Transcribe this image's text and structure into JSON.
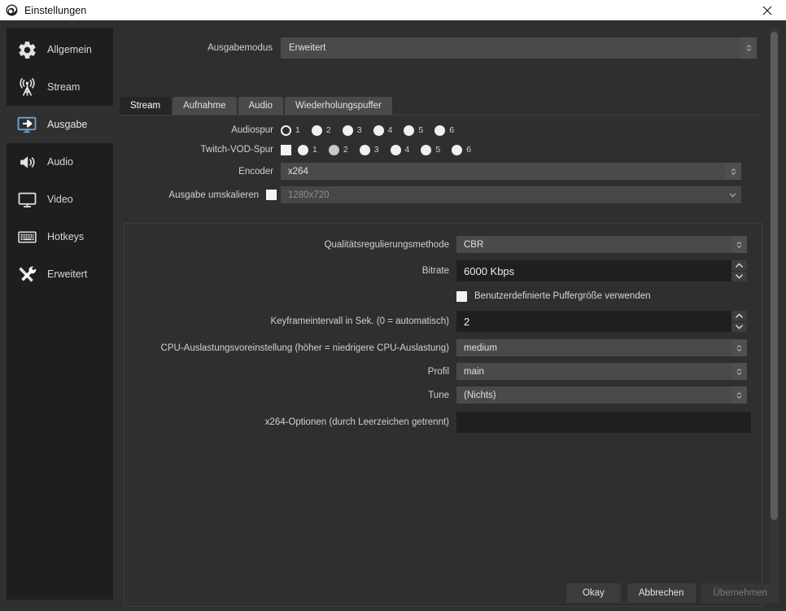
{
  "window": {
    "title": "Einstellungen",
    "icon": "obs-logo-icon",
    "close_label": "×"
  },
  "colors": {
    "titlebar_bg": "#ffffff",
    "dialog_bg": "#2f2f2f",
    "sidebar_bg": "#1e1e1e",
    "sidebar_selected_bg": "#303030",
    "combo_bg": "#4a4a4a",
    "input_bg": "#1f1f1f",
    "accent_icon": "#6ba4d8",
    "text": "#d2d2d2",
    "text_disabled": "#8d8d8d"
  },
  "sidebar": {
    "items": [
      {
        "label": "Allgemein",
        "icon": "gear-icon",
        "selected": false
      },
      {
        "label": "Stream",
        "icon": "broadcast-icon",
        "selected": false
      },
      {
        "label": "Ausgabe",
        "icon": "output-monitor-icon",
        "selected": true
      },
      {
        "label": "Audio",
        "icon": "speaker-icon",
        "selected": false
      },
      {
        "label": "Video",
        "icon": "monitor-icon",
        "selected": false
      },
      {
        "label": "Hotkeys",
        "icon": "keyboard-icon",
        "selected": false
      },
      {
        "label": "Erweitert",
        "icon": "tools-icon",
        "selected": false
      }
    ]
  },
  "output_mode": {
    "label": "Ausgabemodus",
    "value": "Erweitert"
  },
  "tabs": [
    {
      "label": "Stream",
      "active": true
    },
    {
      "label": "Aufnahme",
      "active": false
    },
    {
      "label": "Audio",
      "active": false
    },
    {
      "label": "Wiederholungspuffer",
      "active": false
    }
  ],
  "audio_track": {
    "label": "Audiospur",
    "options": [
      {
        "num": "1",
        "state": "checked"
      },
      {
        "num": "2",
        "state": "unchecked"
      },
      {
        "num": "3",
        "state": "unchecked"
      },
      {
        "num": "4",
        "state": "unchecked"
      },
      {
        "num": "5",
        "state": "unchecked"
      },
      {
        "num": "6",
        "state": "unchecked"
      }
    ]
  },
  "twitch_vod_track": {
    "label": "Twitch-VOD-Spur",
    "checkbox_checked": false,
    "options": [
      {
        "num": "1",
        "state": "unchecked"
      },
      {
        "num": "2",
        "state": "dim"
      },
      {
        "num": "3",
        "state": "unchecked"
      },
      {
        "num": "4",
        "state": "unchecked"
      },
      {
        "num": "5",
        "state": "unchecked"
      },
      {
        "num": "6",
        "state": "unchecked"
      }
    ]
  },
  "encoder": {
    "label": "Encoder",
    "value": "x264"
  },
  "rescale_output": {
    "label": "Ausgabe umskalieren",
    "checked": false,
    "value": "1280x720",
    "enabled": false
  },
  "advanced": {
    "rate_control": {
      "label": "Qualitätsregulierungsmethode",
      "value": "CBR"
    },
    "bitrate": {
      "label": "Bitrate",
      "value": "6000 Kbps"
    },
    "custom_buffer": {
      "label": "Benutzerdefinierte Puffergröße verwenden",
      "checked": false
    },
    "keyframe_interval": {
      "label": "Keyframeintervall in Sek. (0 = automatisch)",
      "value": "2"
    },
    "cpu_preset": {
      "label": "CPU-Auslastungsvoreinstellung (höher = niedrigere CPU-Auslastung)",
      "value": "medium"
    },
    "profile": {
      "label": "Profil",
      "value": "main"
    },
    "tune": {
      "label": "Tune",
      "value": "(Nichts)"
    },
    "x264_options": {
      "label": "x264-Optionen (durch Leerzeichen getrennt)",
      "value": ""
    }
  },
  "footer": {
    "ok": "Okay",
    "cancel": "Abbrechen",
    "apply": "Übernehmen",
    "apply_disabled": true
  }
}
